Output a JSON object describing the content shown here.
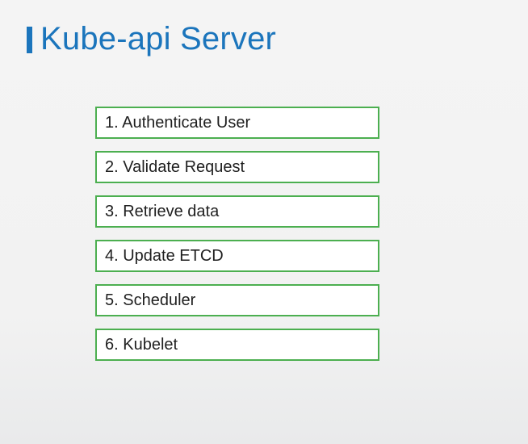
{
  "slide": {
    "title": "Kube-api Server",
    "accent_color": "#1b75bc",
    "box_border_color": "#4caf50"
  },
  "steps": [
    {
      "label": "1. Authenticate User"
    },
    {
      "label": "2. Validate Request"
    },
    {
      "label": "3. Retrieve data"
    },
    {
      "label": "4. Update ETCD"
    },
    {
      "label": "5. Scheduler"
    },
    {
      "label": "6. Kubelet"
    }
  ]
}
